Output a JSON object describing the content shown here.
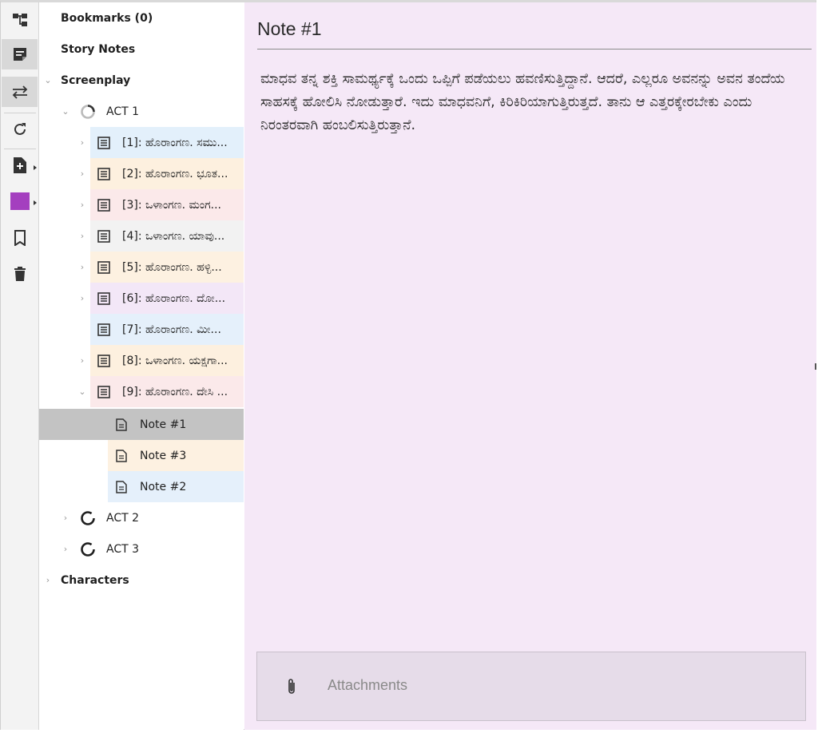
{
  "toolbar": {
    "items": [
      {
        "name": "structure-icon",
        "active": false
      },
      {
        "name": "notes-icon",
        "active": true
      },
      {
        "name": "swap-icon",
        "active": true
      },
      {
        "name": "refresh-icon",
        "active": false
      },
      {
        "name": "add-file-icon",
        "active": false
      },
      {
        "name": "color-swatch",
        "active": false,
        "color": "#a43fbf"
      },
      {
        "name": "bookmark-icon",
        "active": false
      },
      {
        "name": "trash-icon",
        "active": false
      }
    ]
  },
  "tree": {
    "bookmarks": "Bookmarks (0)",
    "story_notes": "Story Notes",
    "screenplay": "Screenplay",
    "act1": "ACT 1",
    "scenes": [
      {
        "label": "[1]: ಹೊರಾಂಗಣ. ಸಮು...",
        "color": "#e3f0fb"
      },
      {
        "label": "[2]: ಹೊರಾಂಗಣ. ಭೂತ...",
        "color": "#fdf0df"
      },
      {
        "label": "[3]: ಒಳಾಂಗಣ. ಮಂಗ...",
        "color": "#fbe9ea"
      },
      {
        "label": "[4]: ಒಳಾಂಗಣ. ಯಾವು...",
        "color": "#f2f2f2"
      },
      {
        "label": "[5]: ಹೊರಾಂಗಣ. ಹಳ್ಳಿ...",
        "color": "#fdf1e1"
      },
      {
        "label": "[6]: ಹೊರಾಂಗಣ. ದೋ...",
        "color": "#f3e7f7"
      },
      {
        "label": "[7]: ಹೊರಾಂಗಣ. ಮೀ...",
        "color": "#e5f0fb"
      },
      {
        "label": "[8]: ಒಳಾಂಗಣ. ಯಕ್ಷಗಾ...",
        "color": "#fdf0df"
      },
      {
        "label": "[9]: ಹೊರಾಂಗಣ. ದೇಸಿ ...",
        "color": "#fbe9ea"
      }
    ],
    "notes": [
      {
        "label": "Note #1",
        "color": "#c3c3c3"
      },
      {
        "label": "Note #3",
        "color": "#fdf1e1"
      },
      {
        "label": "Note #2",
        "color": "#e5f0fb"
      }
    ],
    "act2": "ACT 2",
    "act3": "ACT 3",
    "characters": "Characters"
  },
  "note": {
    "title": "Note #1",
    "body": "ಮಾಧವ ತನ್ನ ಶಕ್ತಿ ಸಾಮರ್ಥ್ಯಕ್ಕೆ ಒಂದು ಒಪ್ಪಿಗೆ ಪಡೆಯಲು ಹವಣಿಸುತ್ತಿದ್ದಾನೆ. ಆದರೆ, ಎಲ್ಲರೂ ಅವನನ್ನು ಅವನ ತಂದೆಯ ಸಾಹಸಕ್ಕೆ ಹೋಲಿಸಿ ನೋಡುತ್ತಾರೆ. ಇದು ಮಾಧವನಿಗೆ, ಕಿರಿಕಿರಿಯಾಗುತ್ತಿರುತ್ತದೆ. ತಾನು ಆ ಎತ್ತರಕ್ಕೇರಬೇಕು ಎಂದು ನಿರಂತರವಾಗಿ ಹಂಬಲಿಸುತ್ತಿರುತ್ತಾನೆ.",
    "background": "#f5e8f7",
    "attachments_label": "Attachments"
  }
}
